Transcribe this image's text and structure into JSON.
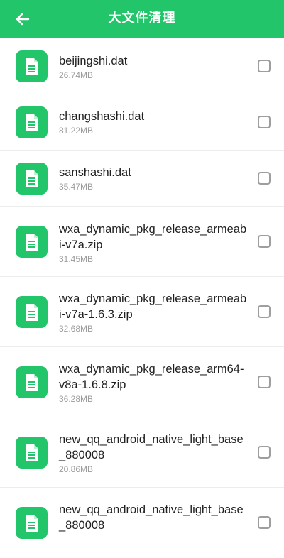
{
  "header": {
    "title": "大文件清理",
    "back_icon": "arrow-left-icon"
  },
  "colors": {
    "accent": "#22c569",
    "text": "#1f1f1f",
    "subtext": "#9c9c9c"
  },
  "files": [
    {
      "name": "beijingshi.dat",
      "size": "26.74MB",
      "checked": false,
      "icon": "document-icon"
    },
    {
      "name": "changshashi.dat",
      "size": "81.22MB",
      "checked": false,
      "icon": "document-icon"
    },
    {
      "name": "sanshashi.dat",
      "size": "35.47MB",
      "checked": false,
      "icon": "document-icon"
    },
    {
      "name": "wxa_dynamic_pkg_release_armeabi-v7a.zip",
      "size": "31.45MB",
      "checked": false,
      "icon": "document-icon"
    },
    {
      "name": "wxa_dynamic_pkg_release_armeabi-v7a-1.6.3.zip",
      "size": "32.68MB",
      "checked": false,
      "icon": "document-icon"
    },
    {
      "name": "wxa_dynamic_pkg_release_arm64-v8a-1.6.8.zip",
      "size": "36.28MB",
      "checked": false,
      "icon": "document-icon"
    },
    {
      "name": "new_qq_android_native_light_base_880008",
      "size": "20.86MB",
      "checked": false,
      "icon": "document-icon"
    },
    {
      "name": "new_qq_android_native_light_base_880008",
      "size": "",
      "checked": false,
      "icon": "document-icon"
    }
  ]
}
